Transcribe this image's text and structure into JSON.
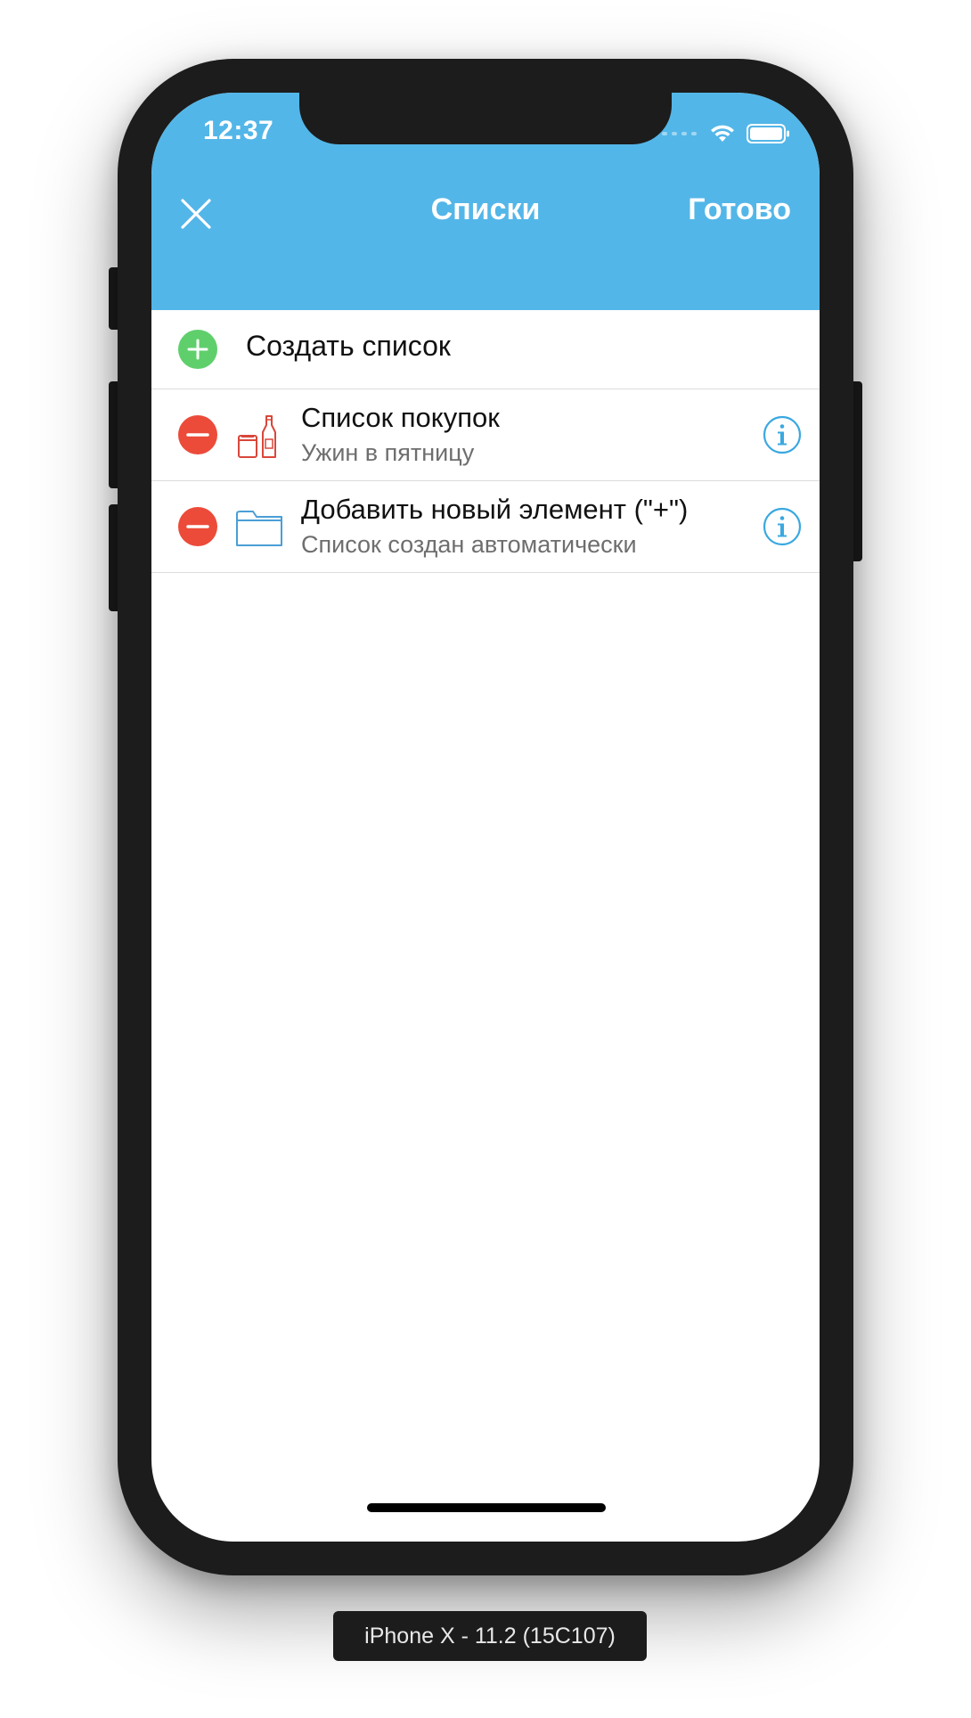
{
  "status_bar": {
    "time": "12:37",
    "icons": [
      "cellular-signal-icon",
      "wifi-icon",
      "battery-icon"
    ]
  },
  "nav": {
    "close_icon": "close-icon",
    "title": "Списки",
    "done_label": "Готово"
  },
  "create_row": {
    "icon": "add-circle-icon",
    "label": "Создать список"
  },
  "lists": [
    {
      "title": "Список покупок",
      "subtitle": "Ужин в пятницу",
      "delete_icon": "delete-circle-icon",
      "type_icon": "grocery-bottles-icon",
      "info_icon": "info-icon"
    },
    {
      "title": "Добавить новый элемент (\"+\")",
      "subtitle": "Список создан автоматически",
      "delete_icon": "delete-circle-icon",
      "type_icon": "folder-icon",
      "info_icon": "info-icon"
    }
  ],
  "device_label": "iPhone X - 11.2 (15C107)",
  "colors": {
    "header_blue": "#53b6e8",
    "add_green": "#5fcf6c",
    "delete_red": "#ec4b3a",
    "grocery_icon_red": "#d9473a",
    "folder_icon_blue": "#4a9fd6",
    "info_blue": "#3aa8e0",
    "phone_frame": "#1c1c1c"
  }
}
